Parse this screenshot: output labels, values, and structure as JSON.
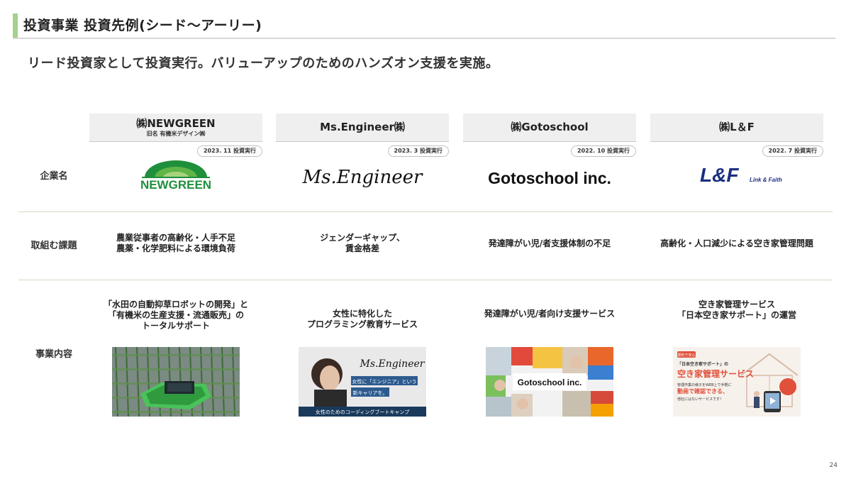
{
  "header": {
    "title": "投資事業 投資先例(シード〜アーリー)",
    "lead": "リード投資家として投資実行。バリューアップのためのハンズオン支援を実施。"
  },
  "row_labels": {
    "company": "企業名",
    "issue": "取組む課題",
    "business": "事業内容"
  },
  "companies": [
    {
      "name": "㈱NEWGREEN",
      "subname": "旧名 有機米デザイン㈱",
      "invested": "2023. 11 投資実行",
      "logo_text": "NEWGREEN",
      "issue": "農業従事者の高齢化・人手不足\n農薬・化学肥料による環境負荷",
      "business": "「水田の自動抑草ロボットの開発」と\n「有機米の生産支援・流通販売」の\nトータルサポート"
    },
    {
      "name": "Ms.Engineer㈱",
      "invested": "2023. 3 投資実行",
      "logo_text": "Ms.Engineer",
      "issue": "ジェンダーギャップ、\n賃金格差",
      "business": "女性に特化した\nプログラミング教育サービス",
      "photo": {
        "brand": "Ms.Engineer",
        "tag1": "女性に「エンジニア」という",
        "tag2": "新キャリアを。",
        "footer": "女性のためのコーディングブートキャンプ"
      }
    },
    {
      "name": "㈱Gotoschool",
      "invested": "2022. 10 投資実行",
      "logo_text": "Gotoschool inc.",
      "issue": "発達障がい児/者支援体制の不足",
      "business": "発達障がい児/者向け支援サービス",
      "photo": {
        "label": "Gotoschool inc."
      }
    },
    {
      "name": "㈱L＆F",
      "invested": "2022. 7 投資実行",
      "logo_text": "L&F",
      "logo_sub": "Link & Faith",
      "issue": "高齢化・人口減少による空き家管理問題",
      "business": "空き家管理サービス\n「日本空き家サポート」の運営",
      "photo": {
        "small": "便利で安心",
        "brand": "「日本空き家サポート」の",
        "headline": "空き家管理サービス",
        "copy1": "管理作業の様子をWEB上で手軽に",
        "copy2": "動画で確認できる、",
        "copy3": "他社にはないサービスです！"
      }
    }
  ],
  "page_number": "24",
  "colors": {
    "accent_green": "#a3d28a",
    "newgreen_green": "#1f8f3c",
    "lf_navy": "#1c2f80"
  }
}
